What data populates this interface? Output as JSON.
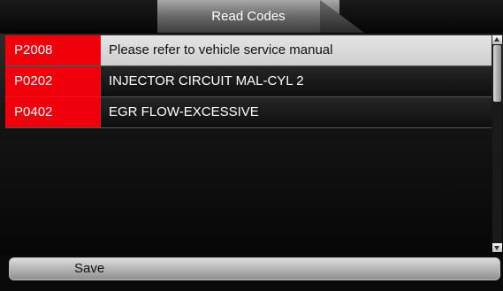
{
  "header": {
    "title": "Read Codes"
  },
  "codes": [
    {
      "code": "P2008",
      "description": "Please refer to vehicle service manual",
      "selected": true
    },
    {
      "code": "P0202",
      "description": "INJECTOR CIRCUIT MAL-CYL 2",
      "selected": false
    },
    {
      "code": "P0402",
      "description": "EGR FLOW-EXCESSIVE",
      "selected": false
    }
  ],
  "colors": {
    "code_bg": "#f0000a",
    "selected_row_bg": "#dcdcdc"
  },
  "footer": {
    "save_label": "Save"
  }
}
